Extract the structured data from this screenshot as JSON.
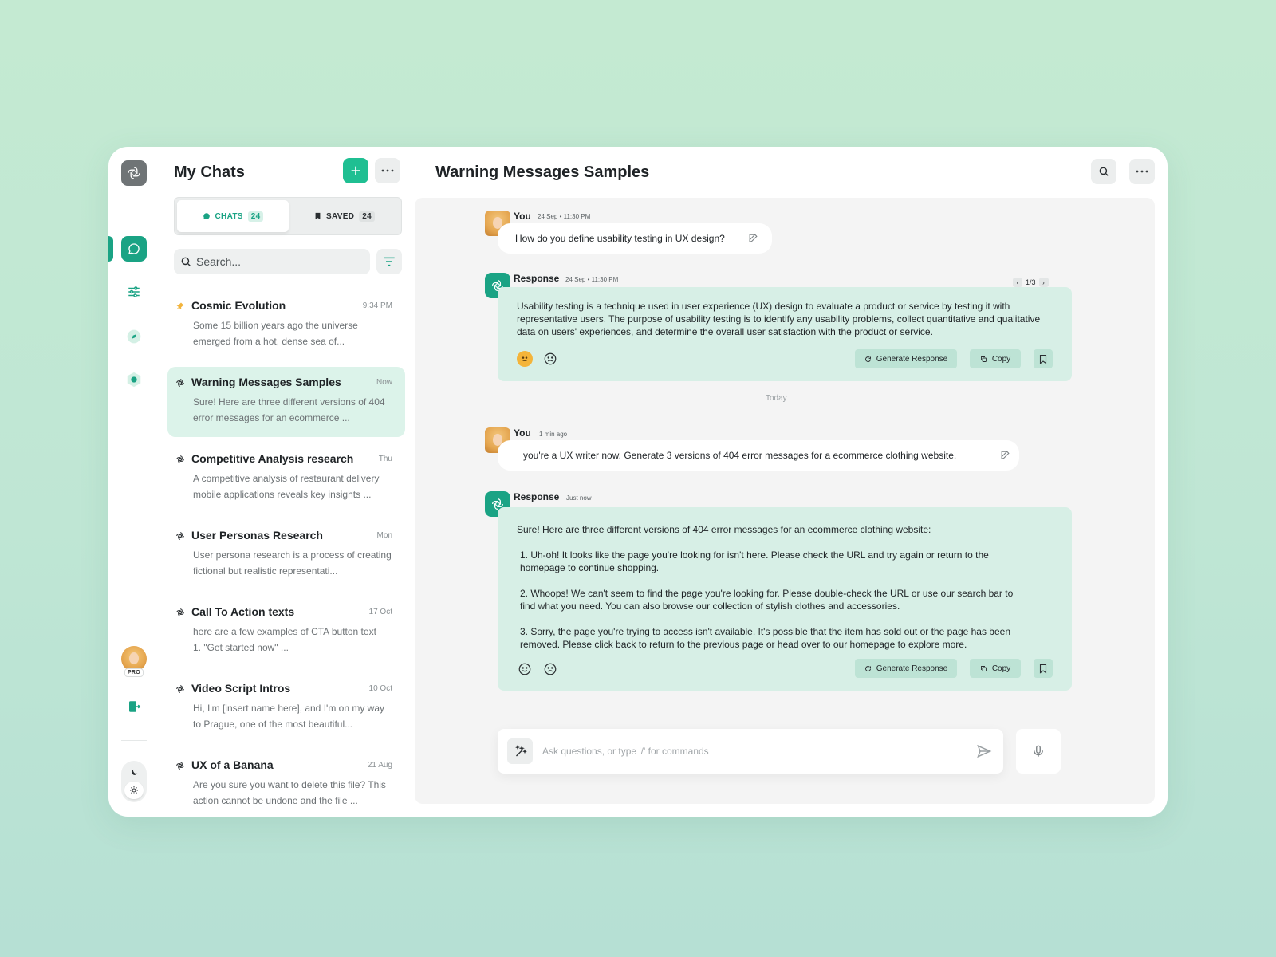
{
  "sidebar": {
    "pro_badge": "PRO"
  },
  "chat_list": {
    "title": "My Chats",
    "tabs": [
      {
        "label": "CHATS",
        "count": "24"
      },
      {
        "label": "SAVED",
        "count": "24"
      }
    ],
    "search_placeholder": "Search...",
    "items": [
      {
        "title": "Cosmic Evolution",
        "time": "9:34 PM",
        "preview": "Some 15 billion years ago the universe emerged from a hot, dense sea of...",
        "icon": "pin-icon",
        "active": false
      },
      {
        "title": "Warning Messages Samples",
        "time": "Now",
        "preview": "Sure! Here are three different versions of 404 error messages for an ecommerce ...",
        "icon": "openai-icon",
        "active": true
      },
      {
        "title": "Competitive Analysis research",
        "time": "Thu",
        "preview": "A competitive analysis of restaurant delivery mobile applications reveals key insights ...",
        "icon": "openai-icon",
        "active": false
      },
      {
        "title": "User Personas Research",
        "time": "Mon",
        "preview": "User persona research is a process of creating fictional but realistic representati...",
        "icon": "openai-icon",
        "active": false
      },
      {
        "title": "Call To Action texts",
        "time": "17 Oct",
        "preview": "here are a few examples of CTA button text\n  1. \"Get started now\" ...",
        "icon": "openai-icon",
        "active": false
      },
      {
        "title": "Video Script Intros",
        "time": "10 Oct",
        "preview": "Hi, I'm [insert name here], and I'm on my way to Prague, one of the most beautiful...",
        "icon": "openai-icon",
        "active": false
      },
      {
        "title": "UX of a Banana",
        "time": "21 Aug",
        "preview": "Are you sure you want to delete this file? This action cannot be undone and the file ...",
        "icon": "openai-icon",
        "active": false
      }
    ]
  },
  "main": {
    "title": "Warning Messages Samples",
    "messages": [
      {
        "author": "You",
        "meta": "24 Sep • 11:30 PM",
        "text": "How do you define usability testing in UX design?"
      },
      {
        "author": "Response",
        "meta": "24 Sep • 11:30 PM",
        "pager": "1/3",
        "text": "Usability testing is a technique used in user experience (UX) design to evaluate a product or service by testing it with representative users. The purpose of usability testing is to identify any usability problems, collect quantitative and qualitative data on users' experiences, and determine the overall user satisfaction with the product or service."
      },
      {
        "author": "You",
        "meta": "1 min ago",
        "text": "you're a UX writer now. Generate 3 versions of 404 error messages for a ecommerce clothing website."
      },
      {
        "author": "Response",
        "meta": "Just now",
        "intro": "Sure! Here are three different versions of 404 error messages for an ecommerce clothing website:",
        "list": [
          "1. Uh-oh! It looks like the page you're looking for isn't here. Please check the URL and try again or return to the homepage to continue shopping.",
          "2. Whoops! We can't seem to find the page you're looking for. Please double-check the URL or use our search bar to find what you need. You can also browse our collection of stylish clothes and accessories.",
          "3. Sorry, the page you're trying to access isn't available. It's possible that the item has sold out or the page has been removed. Please click back to return to the previous page or head over to our homepage to explore more."
        ]
      }
    ],
    "day_separator": "Today",
    "actions": {
      "generate": "Generate Response",
      "copy": "Copy"
    },
    "composer_placeholder": "Ask questions, or type '/' for commands"
  },
  "colors": {
    "accent": "#1aa384",
    "accent_light": "#d7efe6",
    "active_item_bg": "#dcf3ea"
  }
}
